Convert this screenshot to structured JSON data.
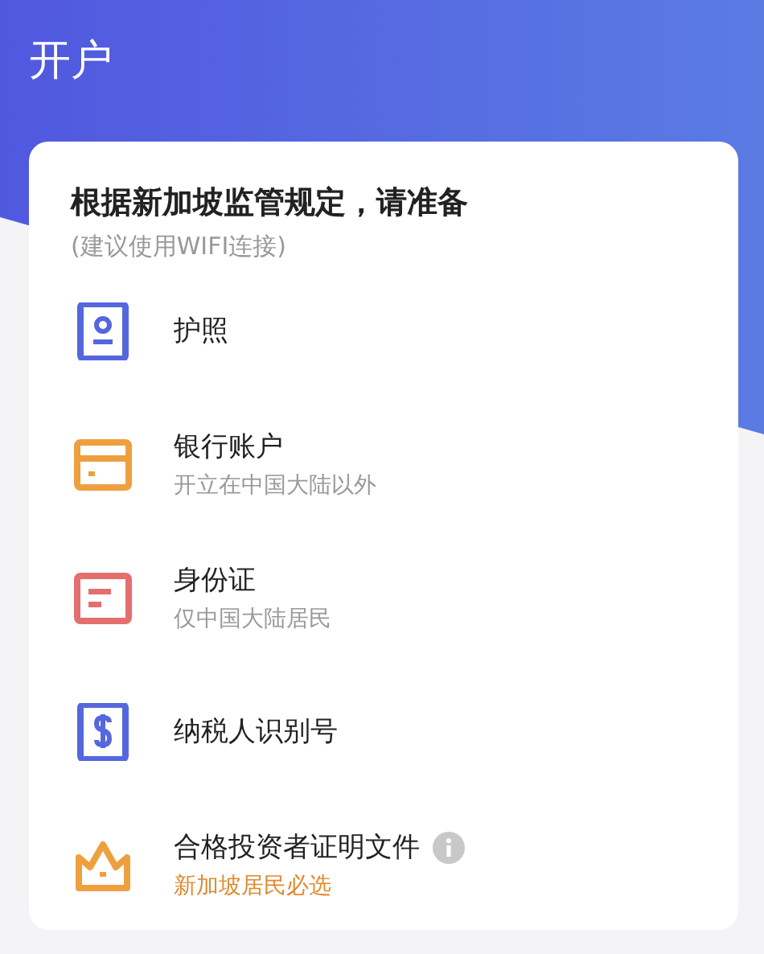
{
  "header": {
    "title": "开户"
  },
  "card": {
    "title": "根据新加坡监管规定，请准备",
    "subtitle": "(建议使用WIFI连接)",
    "items": [
      {
        "kind": "passport",
        "label": "护照",
        "info": false
      },
      {
        "kind": "bank-card",
        "label": "银行账户",
        "note": "开立在中国大陆以外",
        "highlight": false,
        "info": false
      },
      {
        "kind": "id-card",
        "label": "身份证",
        "note": "仅中国大陆居民",
        "highlight": false,
        "info": false
      },
      {
        "kind": "tax",
        "label": "纳税人识别号",
        "info": false
      },
      {
        "kind": "crown",
        "label": "合格投资者证明文件",
        "note": "新加坡居民必选",
        "highlight": true,
        "info": true
      }
    ]
  }
}
